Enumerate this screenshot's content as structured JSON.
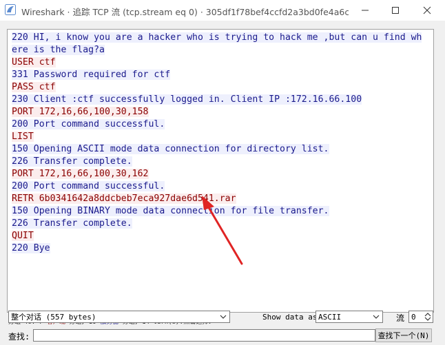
{
  "window": {
    "title": "Wireshark · 追踪 TCP 流 (tcp.stream eq 0) · 305df1f78bef4ccfd2a3bd0fe4a6c0d7...",
    "minimize_icon": "minimize-icon",
    "maximize_icon": "maximize-icon",
    "close_icon": "close-icon"
  },
  "stream": {
    "lines": [
      {
        "dir": "server",
        "text": "220 HI, i know you are a hacker who is trying to hack me ,but can u find where is the flag?a"
      },
      {
        "dir": "client",
        "text": "USER ctf"
      },
      {
        "dir": "server",
        "text": "331 Password required for ctf"
      },
      {
        "dir": "client",
        "text": "PASS ctf"
      },
      {
        "dir": "server",
        "text": "230 Client :ctf successfully logged in. Client IP :172.16.66.100"
      },
      {
        "dir": "client",
        "text": "PORT 172,16,66,100,30,158"
      },
      {
        "dir": "server",
        "text": "200 Port command successful."
      },
      {
        "dir": "client",
        "text": "LIST"
      },
      {
        "dir": "server",
        "text": "150 Opening ASCII mode data connection for directory list."
      },
      {
        "dir": "server",
        "text": "226 Transfer complete."
      },
      {
        "dir": "client",
        "text": "PORT 172,16,66,100,30,162"
      },
      {
        "dir": "server",
        "text": "200 Port command successful."
      },
      {
        "dir": "client",
        "text": "RETR 6b0341642a8ddcbeb7eca927dae6d541.rar"
      },
      {
        "dir": "server",
        "text": "150 Opening BINARY mode data connection for file transfer."
      },
      {
        "dir": "server",
        "text": "226 Transfer complete."
      },
      {
        "dir": "client",
        "text": "QUIT"
      },
      {
        "dir": "server",
        "text": "220 Bye"
      }
    ]
  },
  "status": {
    "client_packets": "分组 46. 7",
    "client_label": "客户端",
    "mid": "分组, 10",
    "server_label": "服务器",
    "tail": "分组, 14 turn(s).点击选择."
  },
  "controls": {
    "conversation_select": "整个对话 (557 bytes)",
    "show_data_label": "Show data as",
    "show_data_select": "ASCII",
    "stream_label": "流",
    "stream_value": "0"
  },
  "find": {
    "label": "查找:",
    "value": "",
    "next_button": "查找下一个(N)"
  },
  "colors": {
    "client_text": "#8b0000",
    "client_bg": "#fbeded",
    "server_text": "#1a1a8c",
    "server_bg": "#eef0fd",
    "arrow": "#e02424"
  }
}
